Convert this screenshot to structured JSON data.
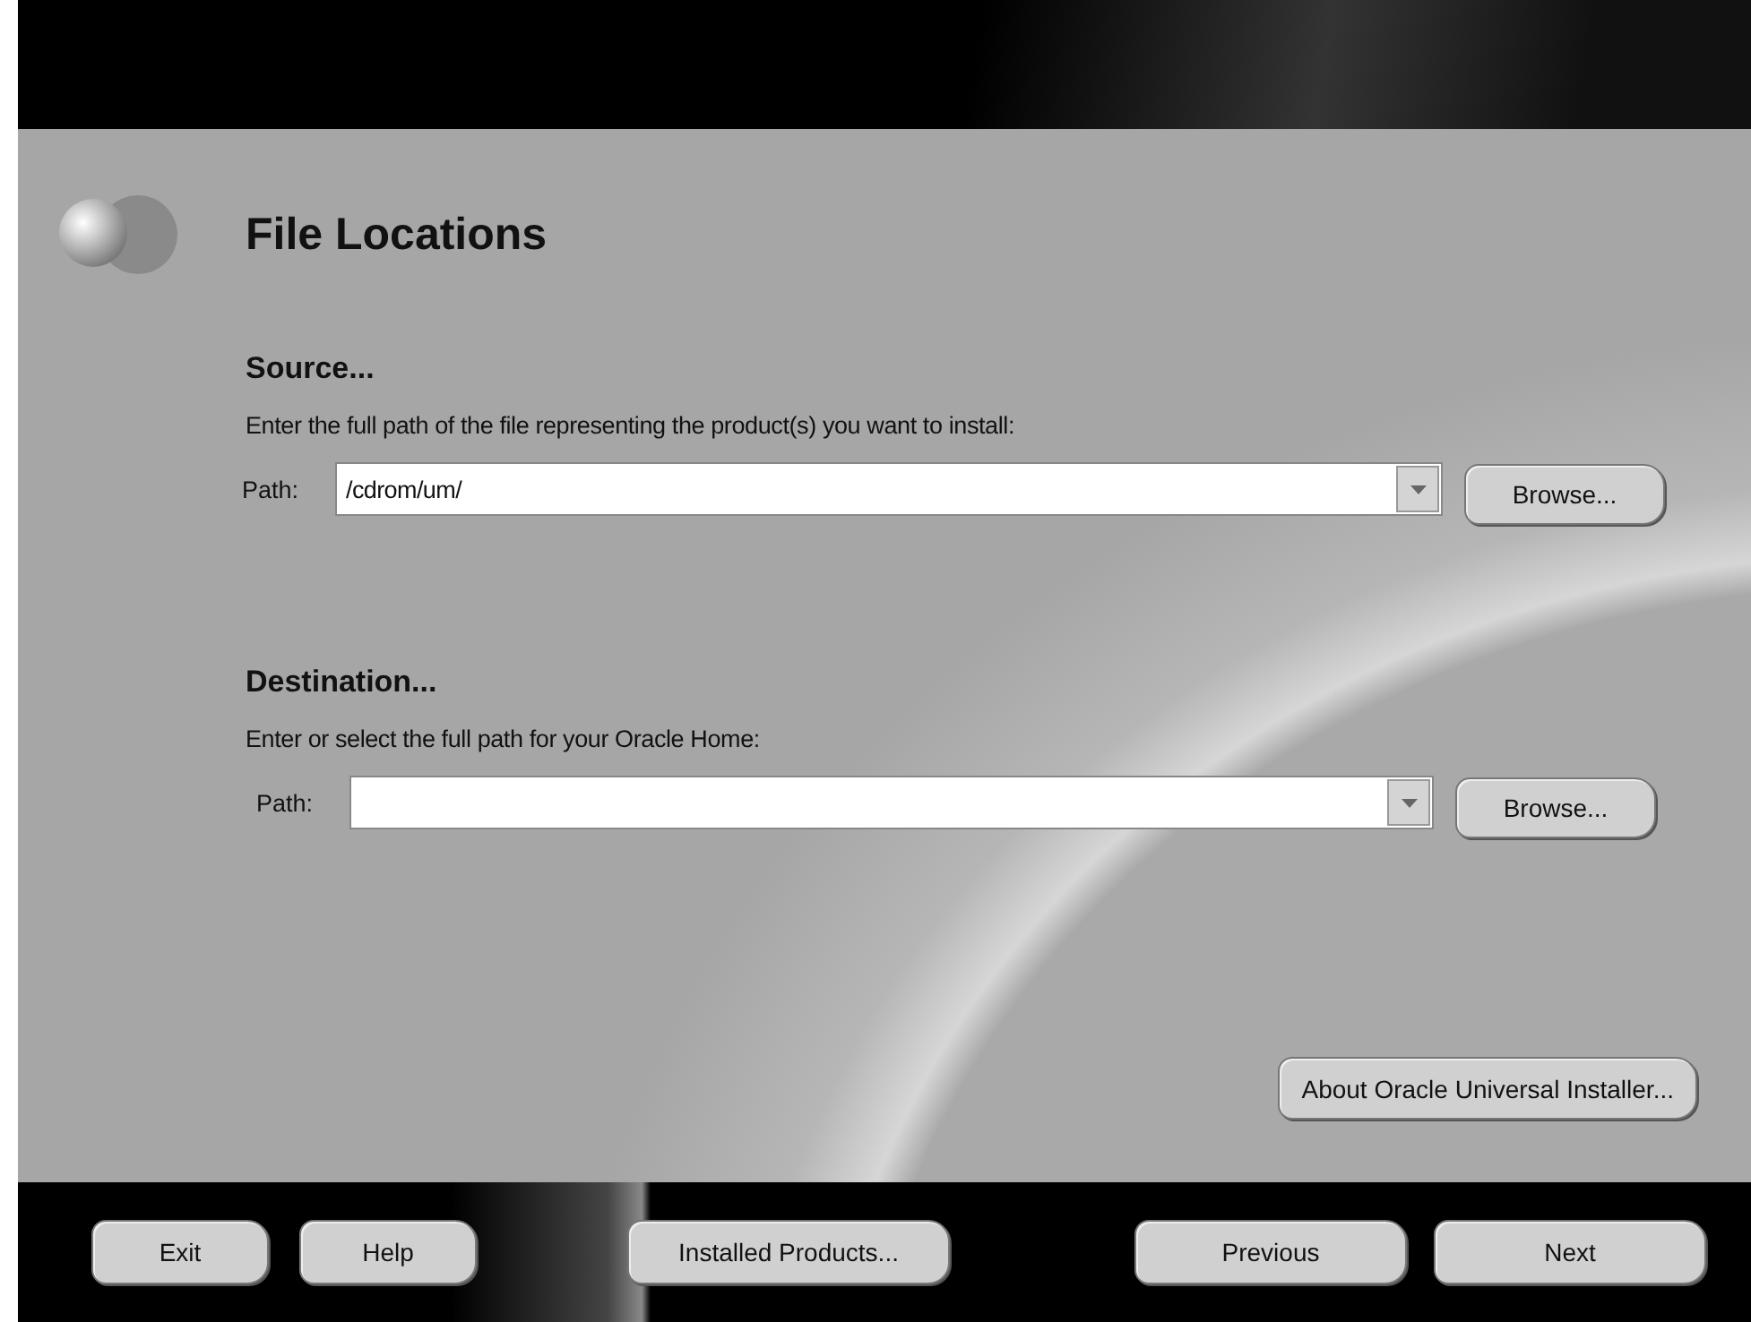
{
  "title": "File Locations",
  "sections": [
    {
      "heading": "Source...",
      "description": "Enter the full path of the file representing the product(s) you want to install:",
      "path_label": "Path:",
      "path_value": "/cdrom/um/",
      "browse": "Browse..."
    },
    {
      "heading": "Destination...",
      "description": "Enter or select the full path for your Oracle Home:",
      "path_label": "Path:",
      "browse": "Browse..."
    }
  ],
  "about_button": "About Oracle Universal Installer...",
  "footer_buttons": [
    {
      "label": "Exit",
      "kind": "left"
    },
    {
      "label": "Help",
      "kind": "left"
    },
    {
      "label": "Installed Products...",
      "kind": "middle"
    },
    {
      "label": "Previous",
      "kind": "right"
    },
    {
      "label": "Next",
      "kind": "right"
    }
  ]
}
